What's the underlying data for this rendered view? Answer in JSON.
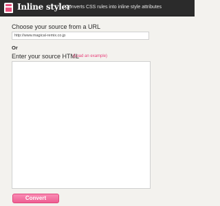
{
  "header": {
    "app_title": "Inline styler",
    "tagline": "Converts CSS rules into inline style attributes",
    "logo_icon": "shopping-bag-icon"
  },
  "form": {
    "url_label": "Choose your source from a URL",
    "url_value": "http://www.magical-remix.co.jp",
    "or_label": "Or",
    "html_label": "Enter your source HTML",
    "example_link": "(Load an example)",
    "html_value": "",
    "convert_label": "Convert"
  },
  "colors": {
    "header_bg": "#2b2b2b",
    "accent": "#e8407a",
    "page_bg": "#f3f2ee"
  }
}
